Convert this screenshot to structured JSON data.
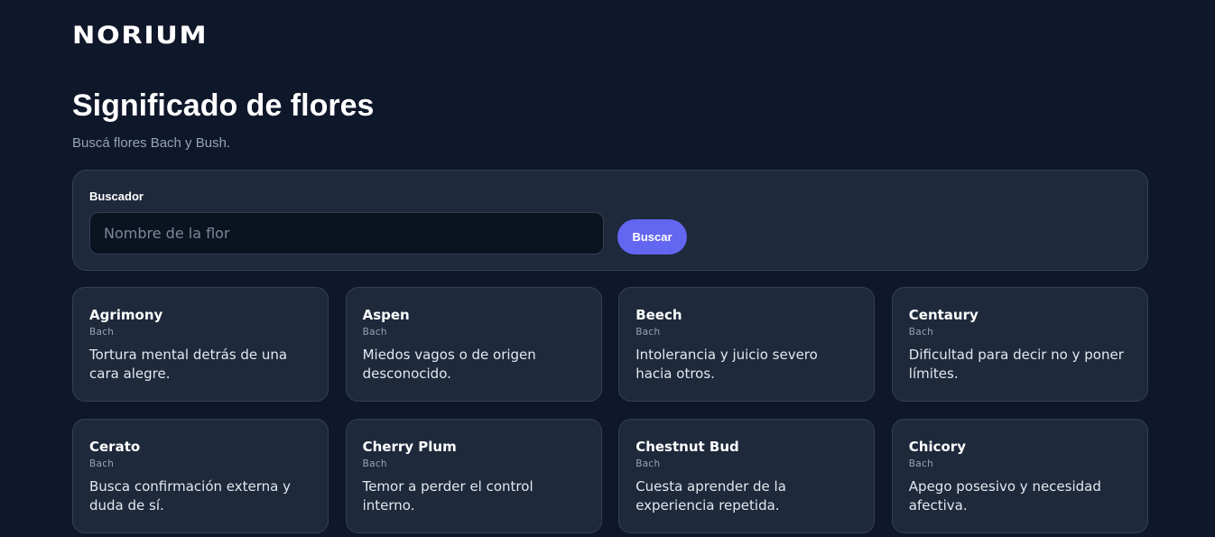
{
  "brand": {
    "logo": "NORIUM"
  },
  "header": {
    "title": "Significado de flores",
    "subtitle": "Buscá flores Bach y Bush."
  },
  "search": {
    "label": "Buscador",
    "placeholder": "Nombre de la flor",
    "value": "",
    "button_label": "Buscar"
  },
  "colors": {
    "background": "#0f172a",
    "panel": "#1e293b",
    "accent": "#6366f1"
  },
  "flowers": [
    {
      "name": "Agrimony",
      "type": "Bach",
      "description": "Tortura mental detrás de una cara alegre."
    },
    {
      "name": "Aspen",
      "type": "Bach",
      "description": "Miedos vagos o de origen desconocido."
    },
    {
      "name": "Beech",
      "type": "Bach",
      "description": "Intolerancia y juicio severo hacia otros."
    },
    {
      "name": "Centaury",
      "type": "Bach",
      "description": "Dificultad para decir no y poner límites."
    },
    {
      "name": "Cerato",
      "type": "Bach",
      "description": "Busca confirmación externa y duda de sí."
    },
    {
      "name": "Cherry Plum",
      "type": "Bach",
      "description": "Temor a perder el control interno."
    },
    {
      "name": "Chestnut Bud",
      "type": "Bach",
      "description": "Cuesta aprender de la experiencia repetida."
    },
    {
      "name": "Chicory",
      "type": "Bach",
      "description": "Apego posesivo y necesidad afectiva."
    }
  ]
}
